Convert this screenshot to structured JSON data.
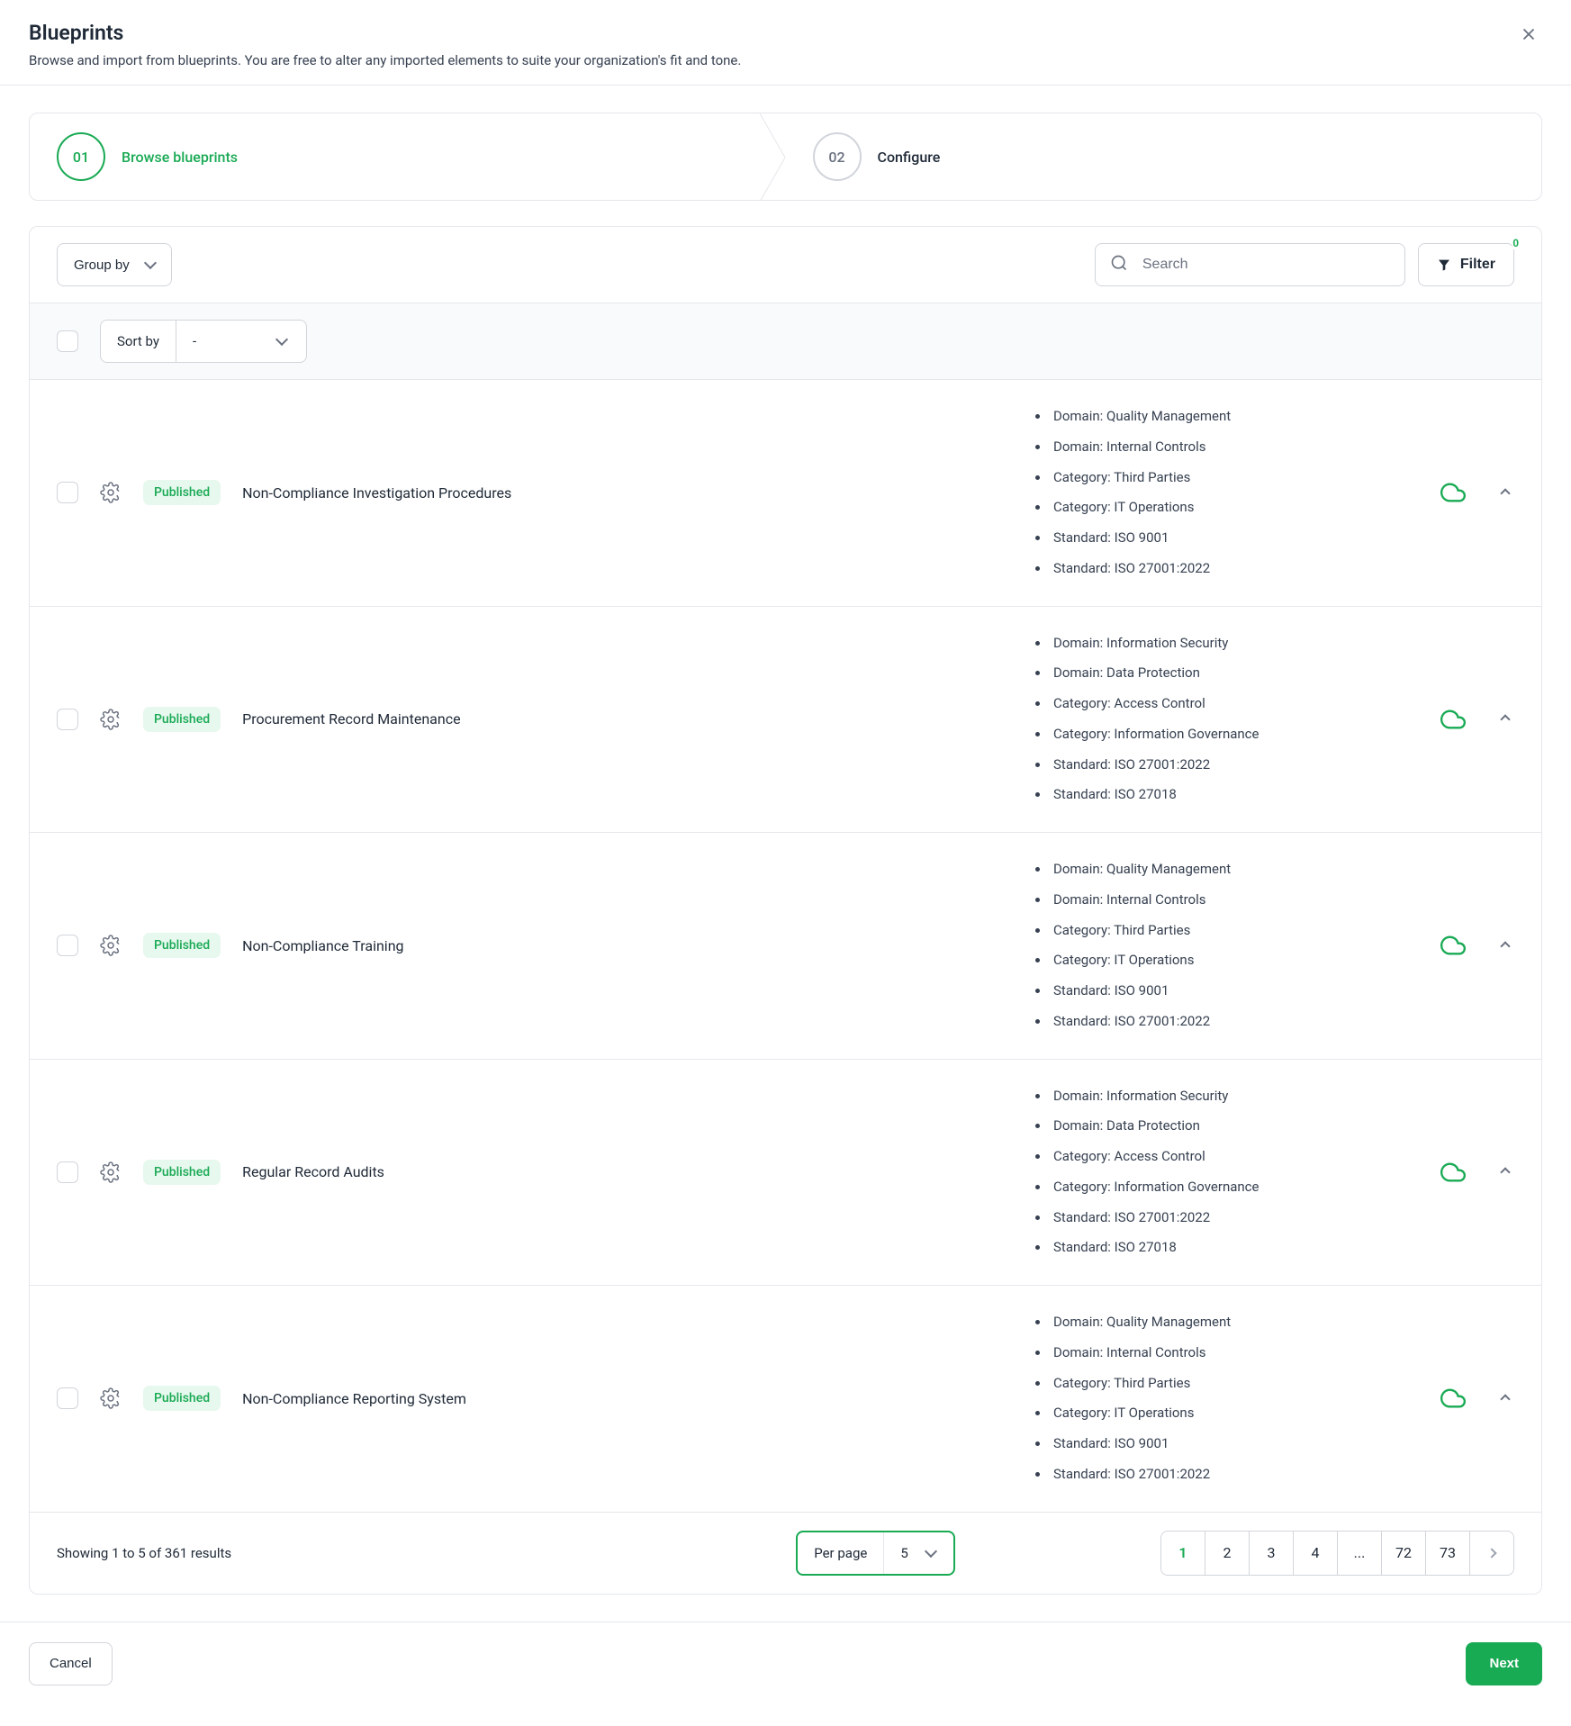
{
  "header": {
    "title": "Blueprints",
    "subtitle": "Browse and import from blueprints. You are free to alter any imported elements to suite your organization's fit and tone."
  },
  "stepper": {
    "step1_num": "01",
    "step1_label": "Browse blueprints",
    "step2_num": "02",
    "step2_label": "Configure"
  },
  "toolbar": {
    "group_by_label": "Group by",
    "search_placeholder": "Search",
    "filter_label": "Filter",
    "filter_count": "0"
  },
  "sort": {
    "sort_by_label": "Sort by",
    "sort_by_value": "-"
  },
  "rows": [
    {
      "status": "Published",
      "title": "Non-Compliance Investigation Procedures",
      "tags": [
        "Domain: Quality Management",
        "Domain: Internal Controls",
        "Category: Third Parties",
        "Category: IT Operations",
        "Standard: ISO 9001",
        "Standard: ISO 27001:2022"
      ]
    },
    {
      "status": "Published",
      "title": "Procurement Record Maintenance",
      "tags": [
        "Domain: Information Security",
        "Domain: Data Protection",
        "Category: Access Control",
        "Category: Information Governance",
        "Standard: ISO 27001:2022",
        "Standard: ISO 27018"
      ]
    },
    {
      "status": "Published",
      "title": "Non-Compliance Training",
      "tags": [
        "Domain: Quality Management",
        "Domain: Internal Controls",
        "Category: Third Parties",
        "Category: IT Operations",
        "Standard: ISO 9001",
        "Standard: ISO 27001:2022"
      ]
    },
    {
      "status": "Published",
      "title": "Regular Record Audits",
      "tags": [
        "Domain: Information Security",
        "Domain: Data Protection",
        "Category: Access Control",
        "Category: Information Governance",
        "Standard: ISO 27001:2022",
        "Standard: ISO 27018"
      ]
    },
    {
      "status": "Published",
      "title": "Non-Compliance Reporting System",
      "tags": [
        "Domain: Quality Management",
        "Domain: Internal Controls",
        "Category: Third Parties",
        "Category: IT Operations",
        "Standard: ISO 9001",
        "Standard: ISO 27001:2022"
      ]
    }
  ],
  "pagination": {
    "results_text": "Showing 1 to 5 of 361 results",
    "per_page_label": "Per page",
    "per_page_value": "5",
    "pages": [
      "1",
      "2",
      "3",
      "4",
      "...",
      "72",
      "73"
    ]
  },
  "footer": {
    "cancel": "Cancel",
    "next": "Next"
  }
}
